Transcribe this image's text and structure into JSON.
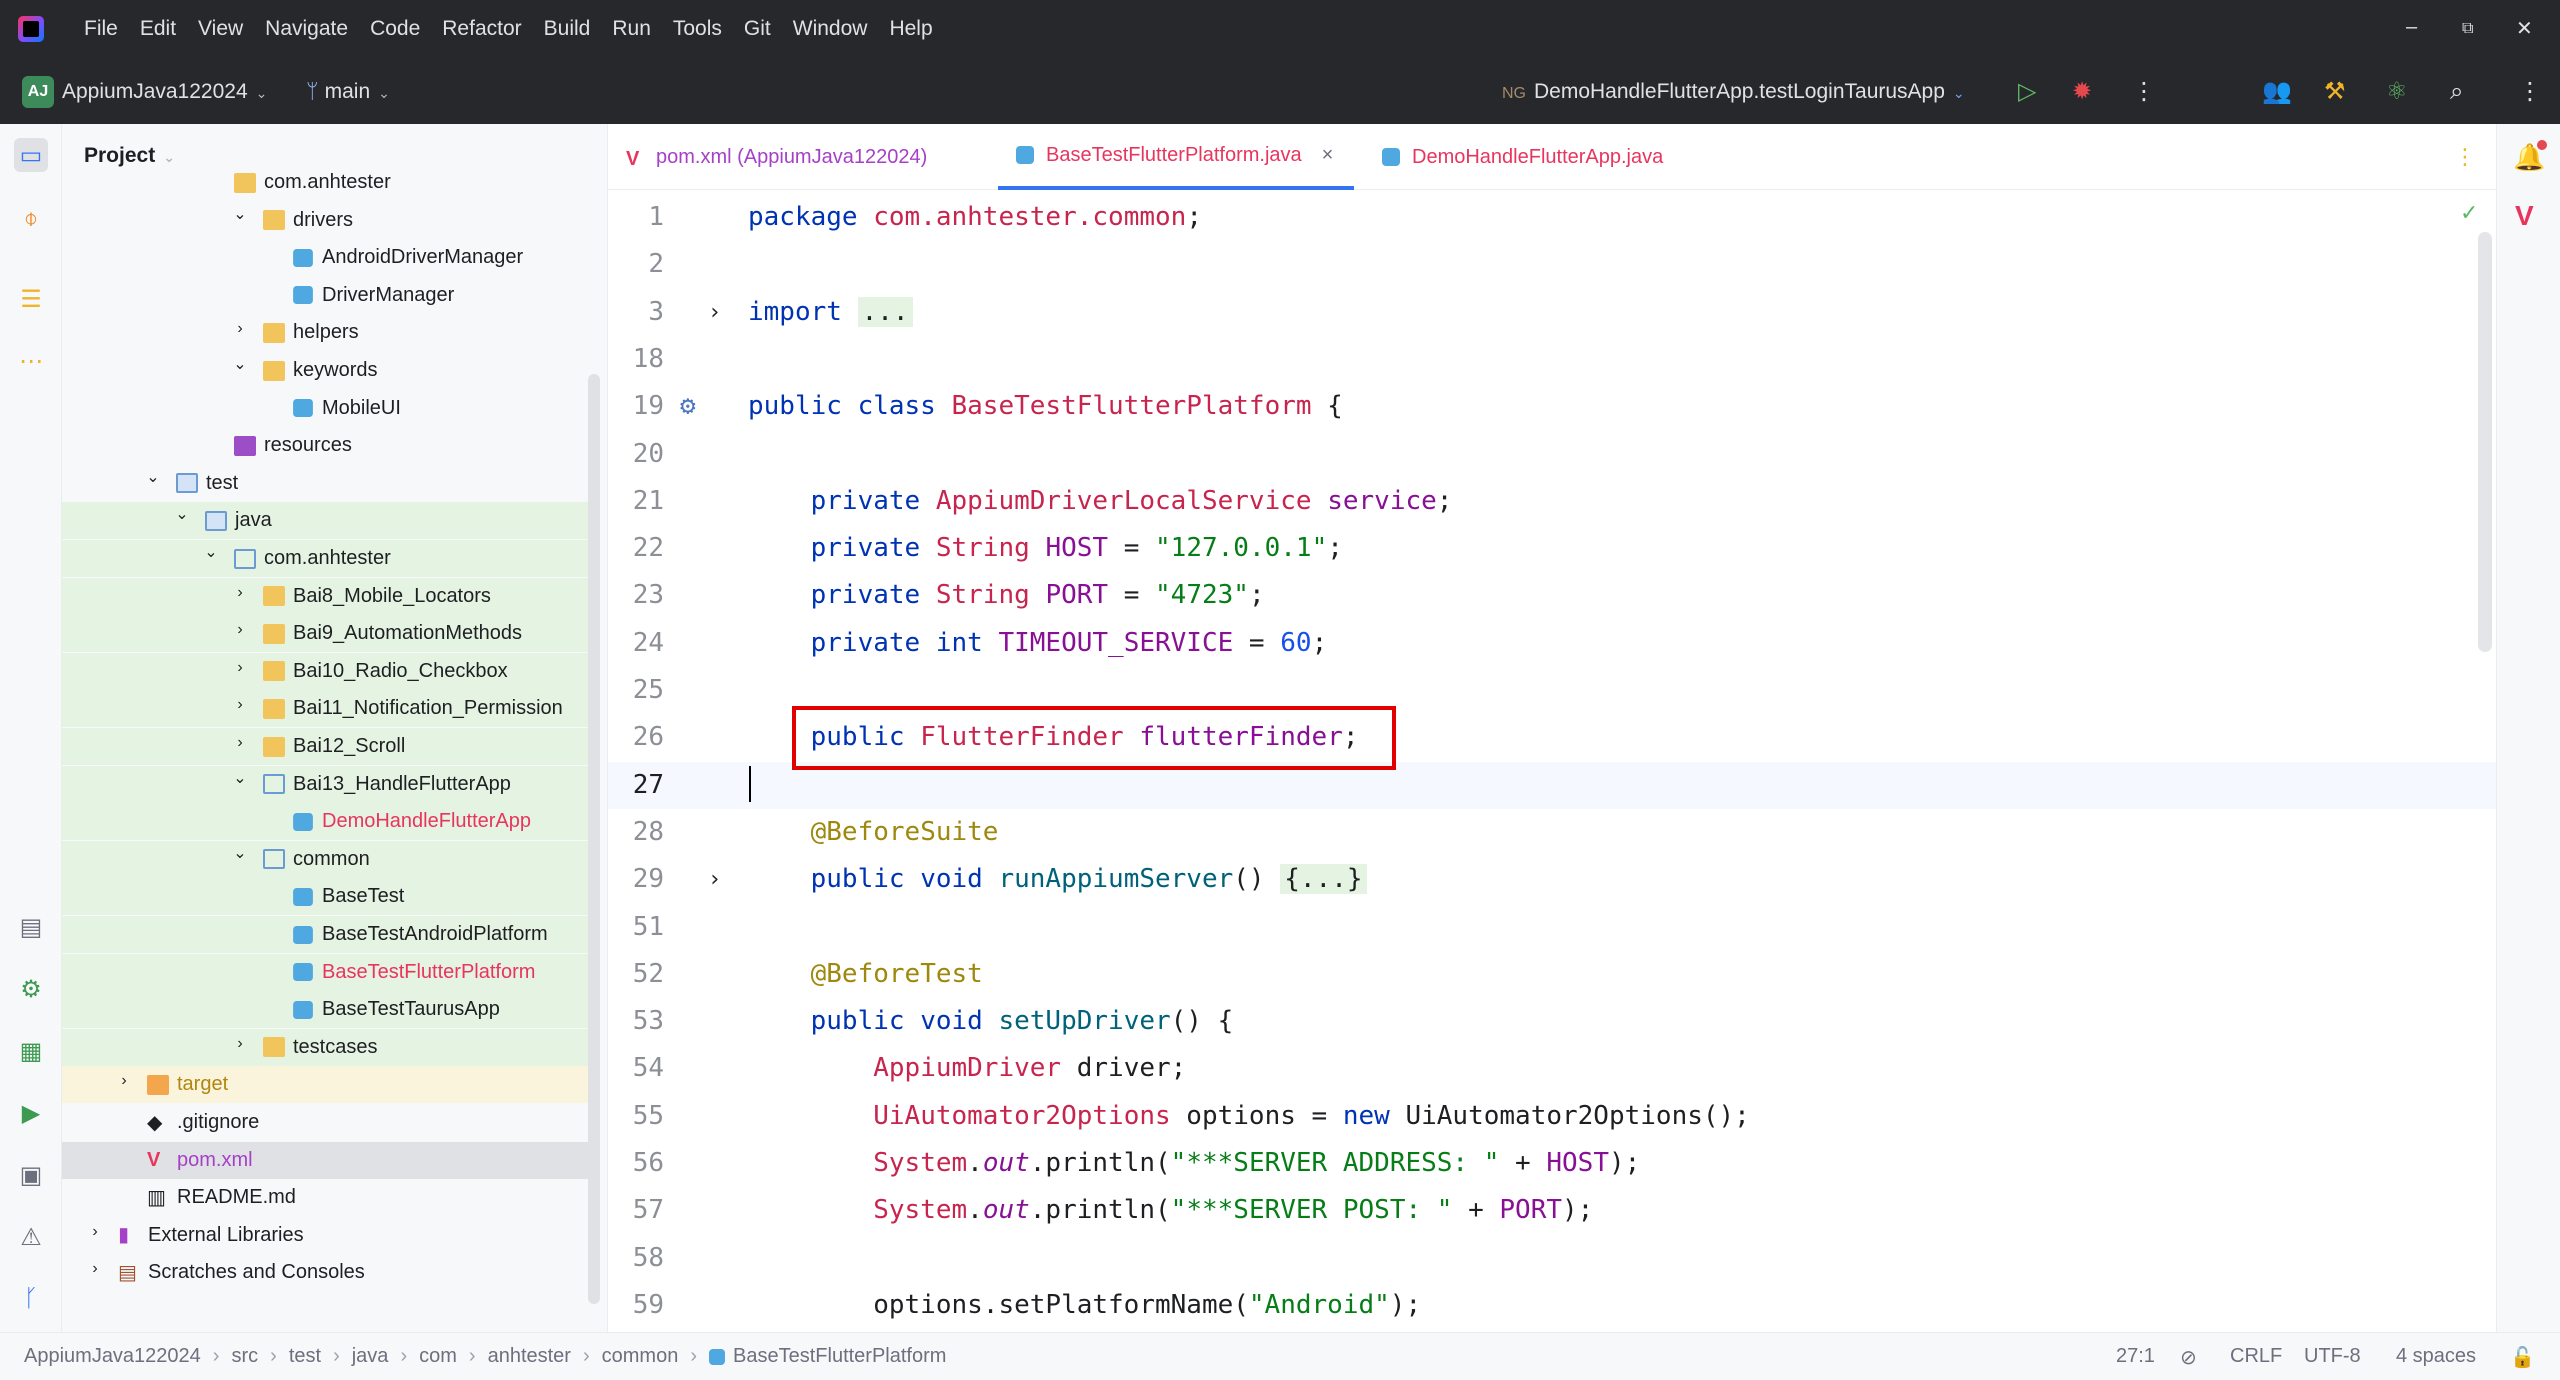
{
  "menu": [
    "File",
    "Edit",
    "View",
    "Navigate",
    "Code",
    "Refactor",
    "Build",
    "Run",
    "Tools",
    "Git",
    "Window",
    "Help"
  ],
  "window_controls": {
    "minimize": "–",
    "restore": "⧉",
    "close": "✕"
  },
  "toolbar": {
    "project_badge": "AJ",
    "project_name": "AppiumJava122024",
    "branch": "main",
    "run_config_badge": "NG",
    "run_config": "DemoHandleFlutterApp.testLoginTaurusApp"
  },
  "project_panel": {
    "title": "Project",
    "tree": [
      {
        "label": "com.anhtester",
        "indent": 4,
        "icon": "folder",
        "arrow": "",
        "bg": ""
      },
      {
        "label": "drivers",
        "indent": 5,
        "icon": "folder",
        "arrow": "down",
        "bg": ""
      },
      {
        "label": "AndroidDriverManager",
        "indent": 6,
        "icon": "class",
        "arrow": "",
        "bg": ""
      },
      {
        "label": "DriverManager",
        "indent": 6,
        "icon": "class",
        "arrow": "",
        "bg": ""
      },
      {
        "label": "helpers",
        "indent": 5,
        "icon": "folder",
        "arrow": "right",
        "bg": ""
      },
      {
        "label": "keywords",
        "indent": 5,
        "icon": "folder",
        "arrow": "down",
        "bg": ""
      },
      {
        "label": "MobileUI",
        "indent": 6,
        "icon": "class",
        "arrow": "",
        "bg": ""
      },
      {
        "label": "resources",
        "indent": 4,
        "icon": "res",
        "arrow": "",
        "bg": ""
      },
      {
        "label": "test",
        "indent": 2,
        "icon": "src",
        "arrow": "down",
        "bg": ""
      },
      {
        "label": "java",
        "indent": 3,
        "icon": "src",
        "arrow": "down",
        "bg": "green"
      },
      {
        "label": "com.anhtester",
        "indent": 4,
        "icon": "outline",
        "arrow": "down",
        "bg": "green"
      },
      {
        "label": "Bai8_Mobile_Locators",
        "indent": 5,
        "icon": "folder",
        "arrow": "right",
        "bg": "green"
      },
      {
        "label": "Bai9_AutomationMethods",
        "indent": 5,
        "icon": "folder",
        "arrow": "right",
        "bg": "green"
      },
      {
        "label": "Bai10_Radio_Checkbox",
        "indent": 5,
        "icon": "folder",
        "arrow": "right",
        "bg": "green"
      },
      {
        "label": "Bai11_Notification_Permission",
        "indent": 5,
        "icon": "folder",
        "arrow": "right",
        "bg": "green"
      },
      {
        "label": "Bai12_Scroll",
        "indent": 5,
        "icon": "folder",
        "arrow": "right",
        "bg": "green"
      },
      {
        "label": "Bai13_HandleFlutterApp",
        "indent": 5,
        "icon": "outline",
        "arrow": "down",
        "bg": "green"
      },
      {
        "label": "DemoHandleFlutterApp",
        "indent": 6,
        "icon": "class",
        "arrow": "",
        "bg": "green",
        "color": "#e8355e"
      },
      {
        "label": "common",
        "indent": 5,
        "icon": "outline",
        "arrow": "down",
        "bg": "green"
      },
      {
        "label": "BaseTest",
        "indent": 6,
        "icon": "class",
        "arrow": "",
        "bg": "green"
      },
      {
        "label": "BaseTestAndroidPlatform",
        "indent": 6,
        "icon": "class",
        "arrow": "",
        "bg": "green"
      },
      {
        "label": "BaseTestFlutterPlatform",
        "indent": 6,
        "icon": "class",
        "arrow": "",
        "bg": "green",
        "color": "#e8355e"
      },
      {
        "label": "BaseTestTaurusApp",
        "indent": 6,
        "icon": "class",
        "arrow": "",
        "bg": "green"
      },
      {
        "label": "testcases",
        "indent": 5,
        "icon": "folder",
        "arrow": "right",
        "bg": "green"
      },
      {
        "label": "target",
        "indent": 1,
        "icon": "target",
        "arrow": "right",
        "bg": "yellow",
        "color": "#b0860e"
      },
      {
        "label": ".gitignore",
        "indent": 1,
        "icon": "git",
        "arrow": "",
        "bg": ""
      },
      {
        "label": "pom.xml",
        "indent": 1,
        "icon": "maven",
        "arrow": "",
        "bg": "selected",
        "color": "#a640c8"
      },
      {
        "label": "README.md",
        "indent": 1,
        "icon": "md",
        "arrow": "",
        "bg": ""
      },
      {
        "label": "External Libraries",
        "indent": 0,
        "icon": "lib",
        "arrow": "right",
        "bg": ""
      },
      {
        "label": "Scratches and Consoles",
        "indent": 0,
        "icon": "scratch",
        "arrow": "right",
        "bg": ""
      }
    ]
  },
  "tabs": [
    {
      "label": "pom.xml (AppiumJava122024)",
      "color": "#a640c8",
      "icon": "maven",
      "active": false
    },
    {
      "label": "BaseTestFlutterPlatform.java",
      "color": "#e8355e",
      "icon": "class",
      "active": true,
      "close": "×"
    },
    {
      "label": "DemoHandleFlutterApp.java",
      "color": "#e8355e",
      "icon": "class",
      "active": false
    }
  ],
  "code": {
    "lines": [
      {
        "n": "1",
        "html": "<span class='kw'>package</span> <span class='cls'>com.anhtester.common</span>;"
      },
      {
        "n": "2",
        "html": ""
      },
      {
        "n": "3",
        "html": "<span class='kw'>import</span> <span class='fold-box'>...</span>",
        "fold": "›"
      },
      {
        "n": "18",
        "html": ""
      },
      {
        "n": "19",
        "html": "<span class='kw'>public class</span> <span class='cls'>BaseTestFlutterPlatform</span> {",
        "gutter": "⚙"
      },
      {
        "n": "20",
        "html": ""
      },
      {
        "n": "21",
        "html": "    <span class='kw'>private</span> <span class='ty'>AppiumDriverLocalService</span> <span class='fld'>service</span>;"
      },
      {
        "n": "22",
        "html": "    <span class='kw'>private</span> <span class='ty'>String</span> <span class='fld'>HOST</span> = <span class='st'>\"127.0.0.1\"</span>;"
      },
      {
        "n": "23",
        "html": "    <span class='kw'>private</span> <span class='ty'>String</span> <span class='fld'>PORT</span> = <span class='st'>\"4723\"</span>;"
      },
      {
        "n": "24",
        "html": "    <span class='kw'>private int</span> <span class='fld'>TIMEOUT_SERVICE</span> = <span class='nm'>60</span>;"
      },
      {
        "n": "25",
        "html": ""
      },
      {
        "n": "26",
        "html": "    <span class='kw'>public</span> <span class='ty'>FlutterFinder</span> <span class='fld'>flutterFinder</span>;"
      },
      {
        "n": "27",
        "html": "",
        "current": true
      },
      {
        "n": "28",
        "html": "    <span class='an'>@BeforeSuite</span>"
      },
      {
        "n": "29",
        "html": "    <span class='kw'>public void</span> <span class='fn'>runAppiumServer</span>() <span class='fold-box'>{...}</span>",
        "fold": "›"
      },
      {
        "n": "51",
        "html": ""
      },
      {
        "n": "52",
        "html": "    <span class='an'>@BeforeTest</span>"
      },
      {
        "n": "53",
        "html": "    <span class='kw'>public void</span> <span class='fn'>setUpDriver</span>() {"
      },
      {
        "n": "54",
        "html": "        <span class='ty'>AppiumDriver</span> driver;"
      },
      {
        "n": "55",
        "html": "        <span class='ty'>UiAutomator2Options</span> options = <span class='kw'>new</span> UiAutomator2Options();"
      },
      {
        "n": "56",
        "html": "        <span class='ty'>System</span>.<span class='it'>out</span>.println(<span class='st'>\"***SERVER ADDRESS: \"</span> + <span class='fld'>HOST</span>);"
      },
      {
        "n": "57",
        "html": "        <span class='ty'>System</span>.<span class='it'>out</span>.println(<span class='st'>\"***SERVER POST: \"</span> + <span class='fld'>PORT</span>);"
      },
      {
        "n": "58",
        "html": ""
      },
      {
        "n": "59",
        "html": "        options.setPlatformName(<span class='st'>\"Android\"</span>);"
      }
    ]
  },
  "status_bar": {
    "breadcrumbs": [
      "AppiumJava122024",
      "src",
      "test",
      "java",
      "com",
      "anhtester",
      "common",
      "BaseTestFlutterPlatform"
    ],
    "position": "27:1",
    "line_ending": "CRLF",
    "encoding": "UTF-8",
    "indent": "4 spaces"
  },
  "colors": {
    "accent": "#3574f0",
    "highlight_border": "#e00000",
    "tree_green": "#e5f3e2"
  }
}
